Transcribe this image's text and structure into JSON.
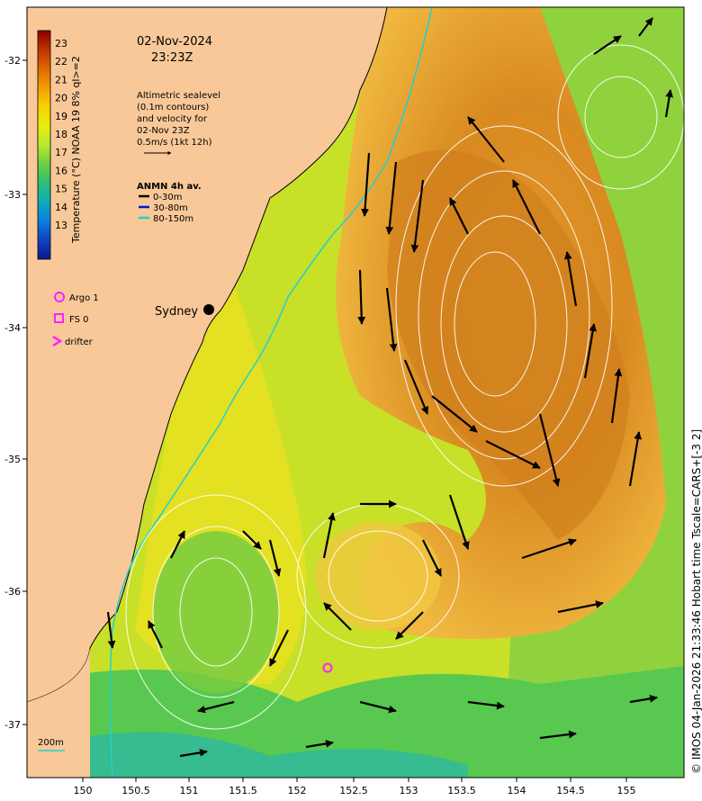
{
  "header": {
    "date": "02-Nov-2024",
    "time": "23:23Z"
  },
  "colorbar": {
    "title": "Temperature (°C) NOAA 19 8% ql>=2",
    "ticks": [
      "23",
      "22",
      "21",
      "20",
      "19",
      "18",
      "17",
      "16",
      "15",
      "14",
      "13"
    ],
    "colors": [
      "#8b0000",
      "#c03000",
      "#e06a00",
      "#f2a000",
      "#f7d000",
      "#e8ef10",
      "#b8e830",
      "#6fd040",
      "#30c070",
      "#10b0b0",
      "#0a80e0",
      "#1040c0",
      "#0a1a8c"
    ]
  },
  "altimetry_note": {
    "lines": [
      "Altimetric sealevel",
      "(0.1m contours)",
      "and velocity for",
      "02-Nov 23Z",
      "0.5m/s (1kt 12h)"
    ]
  },
  "anmn_legend": {
    "title": "ANMN 4h av.",
    "items": [
      {
        "label": "0-30m",
        "color": "#000000"
      },
      {
        "label": "30-80m",
        "color": "#1010d0"
      },
      {
        "label": "80-150m",
        "color": "#20d0d0"
      }
    ]
  },
  "markers_legend": {
    "items": [
      {
        "label": "Argo 1",
        "symbol": "circle",
        "color": "#ff20ff"
      },
      {
        "label": "FS 0",
        "symbol": "square",
        "color": "#ff20ff"
      },
      {
        "label": "drifter",
        "symbol": "chevron",
        "color": "#ff20ff"
      }
    ]
  },
  "place": {
    "name": "Sydney"
  },
  "depth_label": "200m",
  "axes": {
    "x_ticks": [
      "150",
      "150.5",
      "151",
      "151.5",
      "152",
      "152.5",
      "153",
      "153.5",
      "154",
      "154.5",
      "155"
    ],
    "y_ticks": [
      "-32",
      "-33",
      "-34",
      "-35",
      "-36",
      "-37"
    ]
  },
  "credit": "© IMOS 04-Jan-2026 21:33:46 Hobart time Tscale=CARS+[-3 2]",
  "colors": {
    "land": "#f8c898",
    "coast": "#000000",
    "contour": "#ffffff",
    "shelf_line": "#20d0d0"
  }
}
